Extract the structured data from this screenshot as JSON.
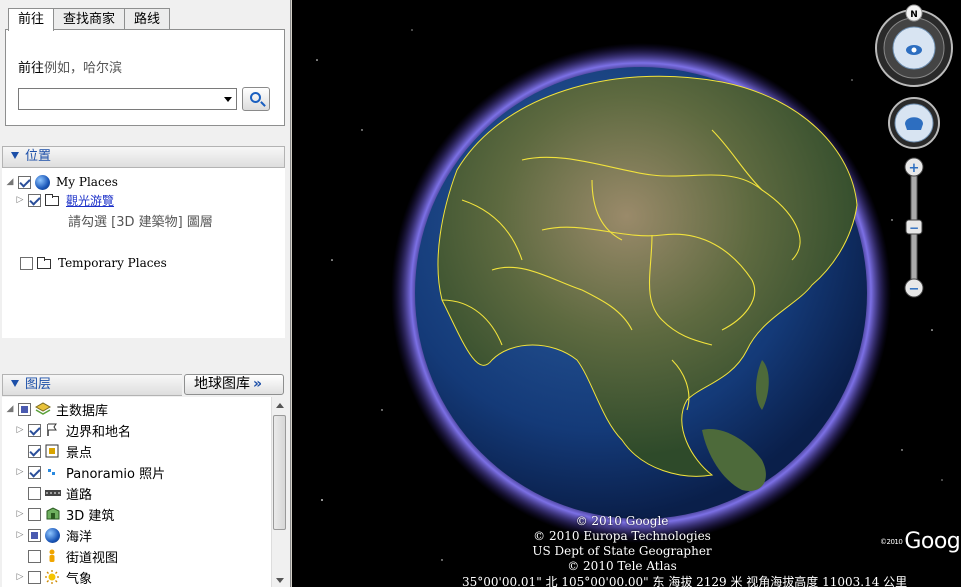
{
  "search": {
    "tabs": [
      "前往",
      "查找商家",
      "路线"
    ],
    "goto_label": "前往",
    "goto_example": "例如，哈尔滨",
    "input_value": "",
    "placeholder": ""
  },
  "places": {
    "header": "位置",
    "items": [
      {
        "label": "My Places"
      },
      {
        "label": "觀光游覽"
      },
      {
        "label": "Temporary Places"
      }
    ],
    "note": "請勾選 [3D 建築物] 圖層"
  },
  "layers": {
    "header": "图层",
    "gallery_button": "地球图库",
    "gallery_chevron": "»",
    "items": [
      {
        "label": "主数据库"
      },
      {
        "label": "边界和地名"
      },
      {
        "label": "景点"
      },
      {
        "label": "Panoramio 照片"
      },
      {
        "label": "道路"
      },
      {
        "label": "3D 建筑"
      },
      {
        "label": "海洋"
      },
      {
        "label": "街道视图"
      },
      {
        "label": "气象"
      }
    ]
  },
  "map": {
    "copyright": [
      "© 2010 Google",
      "© 2010 Europa Technologies",
      "US Dept of State Geographer",
      "© 2010 Tele Atlas"
    ],
    "status": "35°00'00.01\" 北    105°00'00.00\" 东   海拔 2129 米 视角海拔高度 11003.14 公里",
    "logo": "Google",
    "logo_year": "©2010",
    "compass_n": "N"
  },
  "colors": {
    "accent": "#1c4fa8",
    "border_yellow": "#f2e33c",
    "atmosphere": "#6a5cff"
  }
}
